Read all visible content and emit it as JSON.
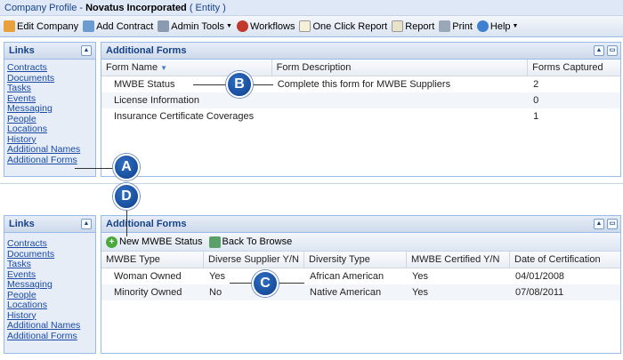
{
  "title": {
    "prefix": "Company Profile - ",
    "company": "Novatus Incorporated",
    "suffix": " ( Entity )"
  },
  "toolbar": [
    {
      "label": "Edit Company",
      "icon": "edit-icon",
      "color": "#e9a23b"
    },
    {
      "label": "Add Contract",
      "icon": "add-contract-icon",
      "color": "#6c9bd2"
    },
    {
      "label": "Admin Tools",
      "icon": "wrench-icon",
      "color": "#8a9ab0",
      "dropdown": true
    },
    {
      "label": "Workflows",
      "icon": "workflow-icon",
      "color": "#c0392b"
    },
    {
      "label": "One Click Report",
      "icon": "report-icon",
      "color": "#f5f0d8"
    },
    {
      "label": "Report",
      "icon": "report-icon",
      "color": "#e8e2c8"
    },
    {
      "label": "Print",
      "icon": "printer-icon",
      "color": "#9aa7b8"
    },
    {
      "label": "Help",
      "icon": "help-icon",
      "color": "#3f7fd0",
      "dropdown": true
    }
  ],
  "links_panel": {
    "title": "Links",
    "items": [
      "Contracts",
      "Documents",
      "Tasks",
      "Events",
      "Messaging",
      "People",
      "Locations",
      "History",
      "Additional Names",
      "Additional Forms"
    ]
  },
  "forms_panel": {
    "title": "Additional Forms",
    "columns": [
      "Form Name",
      "Form Description",
      "Forms Captured"
    ],
    "rows": [
      [
        "MWBE Status",
        "Complete this form for MWBE Suppliers",
        "2"
      ],
      [
        "License Information",
        "",
        "0"
      ],
      [
        "Insurance Certificate Coverages",
        "",
        "1"
      ]
    ]
  },
  "mwbe_panel": {
    "title": "Additional Forms",
    "new_button": "New MWBE Status",
    "back_button": "Back To Browse",
    "columns": [
      "MWBE Type",
      "Diverse Supplier Y/N",
      "Diversity Type",
      "MWBE Certified Y/N",
      "Date of Certification"
    ],
    "rows": [
      [
        "Woman Owned",
        "Yes",
        "African American",
        "Yes",
        "04/01/2008"
      ],
      [
        "Minority Owned",
        "No",
        "Native American",
        "Yes",
        "07/08/2011"
      ]
    ]
  },
  "callouts": [
    "A",
    "B",
    "C",
    "D"
  ],
  "colors": {
    "accent": "#15428b",
    "callout": "#1a56a8",
    "link": "#1a4aa5"
  }
}
